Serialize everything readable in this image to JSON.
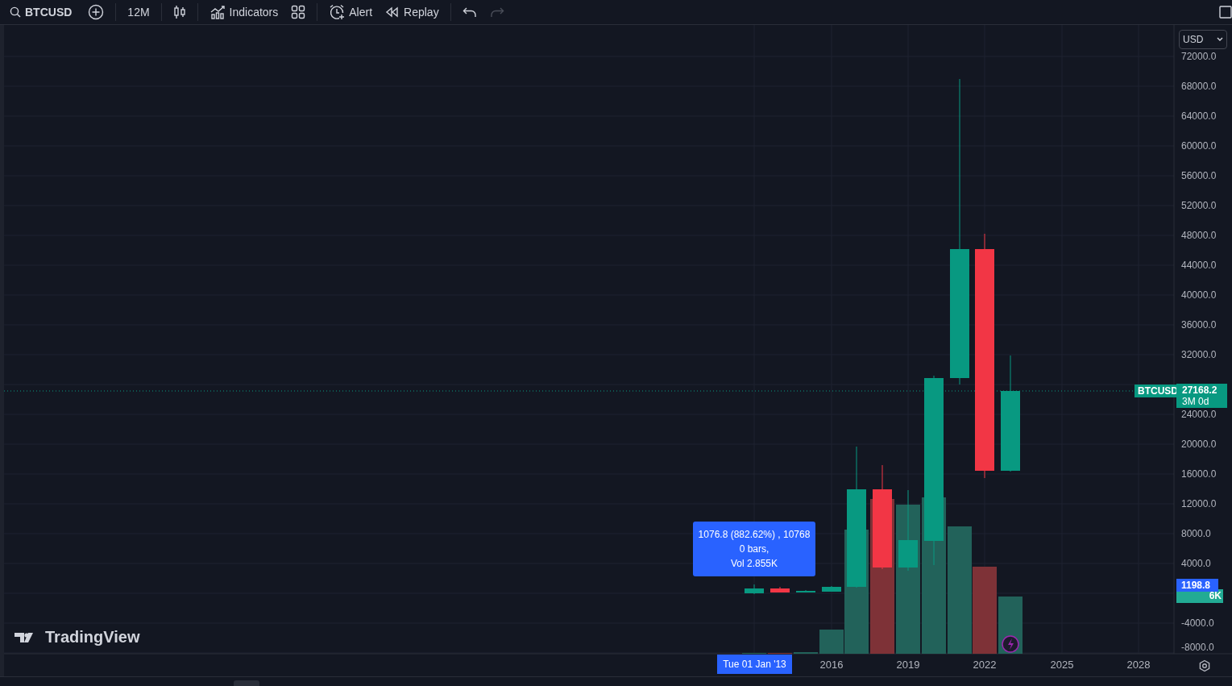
{
  "toolbar": {
    "symbol": "BTCUSD",
    "interval": "12M",
    "indicators": "Indicators",
    "alert": "Alert",
    "replay": "Replay",
    "undo": {
      "disabled": false
    },
    "redo": {
      "disabled": true
    }
  },
  "chart": {
    "currency": "USD",
    "price_ticks": [
      "72000.0",
      "68000.0",
      "64000.0",
      "60000.0",
      "56000.0",
      "52000.0",
      "48000.0",
      "44000.0",
      "40000.0",
      "36000.0",
      "32000.0",
      "24000.0",
      "20000.0",
      "16000.0",
      "12000.0",
      "8000.0",
      "4000.0",
      "-4000.0",
      "-8000.0"
    ],
    "time_ticks": [
      "2016",
      "2019",
      "2022",
      "2025",
      "2028"
    ],
    "last_price": {
      "symbol": "BTCUSD",
      "price": "27168.2",
      "countdown": "3M 0d"
    },
    "crosshair_price": "1198.8",
    "volume_label": "6K",
    "measure_tooltip": [
      "1076.8 (882.62%) , 10768",
      "0 bars,",
      "Vol 2.855K"
    ],
    "crosshair_date": "Tue 01 Jan '13",
    "logo": "TradingView"
  }
}
